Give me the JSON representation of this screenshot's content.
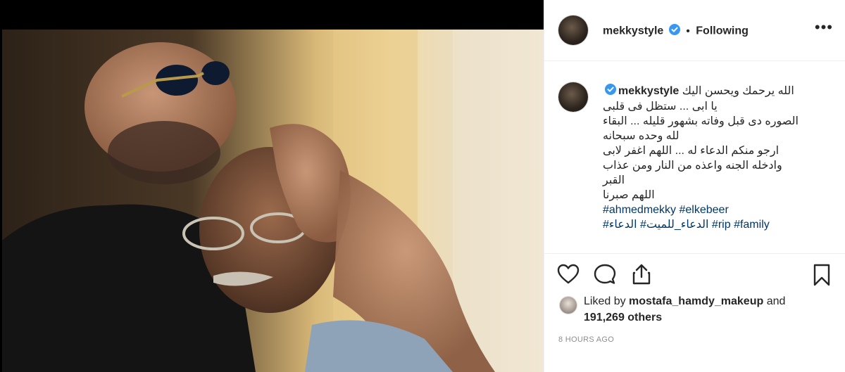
{
  "post": {
    "username": "mekkystyle",
    "follow_status": "Following",
    "separator": "•",
    "more_label": "•••",
    "caption_lines": [
      "الله يرحمك ويحسن اليك",
      "يا ابى ... ستظل فى قلبى",
      "الصوره دى قبل وفاته بشهور قليله ... البقاء",
      "لله وحده سبحانه",
      "ارجو منكم الدعاء له ... اللهم اغفر لابى",
      "وادخله الجنه واعذه من النار ومن عذاب",
      "القبر",
      "اللهم صبرنا"
    ],
    "hashtags_line1": [
      "#ahmedmekky",
      "#elkebeer"
    ],
    "hashtags_line2": [
      "#الدعاء",
      "#الدعاء_للميت",
      "#rip",
      "#family"
    ],
    "likes": {
      "prefix": "Liked by",
      "user": "mostafa_hamdy_makeup",
      "and": "and",
      "count": "191,269 others"
    },
    "timestamp": "8 HOURS AGO"
  },
  "icons": {
    "verified": "verified-badge-icon",
    "like": "heart-icon",
    "comment": "comment-icon",
    "share": "share-icon",
    "save": "bookmark-icon"
  },
  "colors": {
    "verified_blue": "#3897f0",
    "hashtag": "#00376b",
    "text": "#262626",
    "muted": "#8e8e8e",
    "border": "#efefef"
  }
}
